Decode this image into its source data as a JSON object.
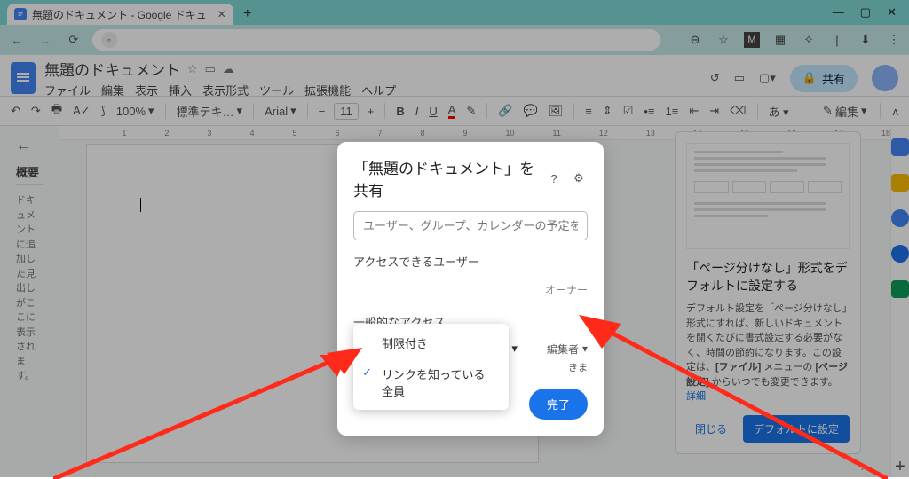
{
  "browser": {
    "tab_title": "無題のドキュメント - Google ドキュ",
    "win": {
      "min": "—",
      "max": "▢",
      "close": "✕"
    }
  },
  "docs": {
    "title": "無題のドキュメント",
    "menus": [
      "ファイル",
      "編集",
      "表示",
      "挿入",
      "表示形式",
      "ツール",
      "拡張機能",
      "ヘルプ"
    ],
    "share_label": "共有"
  },
  "toolbar": {
    "zoom": "100%",
    "style": "標準テキ…",
    "font": "Arial",
    "font_size": "11",
    "edit_mode": "編集"
  },
  "outline": {
    "heading": "概要",
    "hint": "ドキュメントに追加した見出しがここに表示されます。"
  },
  "ruler_marks": [
    "1",
    "2",
    "3",
    "4",
    "5",
    "6",
    "7",
    "8",
    "9",
    "10",
    "11",
    "12",
    "13",
    "14",
    "15",
    "16",
    "17",
    "18"
  ],
  "companion": {
    "title": "「ページ分けなし」形式をデフォルトに設定する",
    "body_pre": "デフォルト設定を「ページ分けなし」形式にすれば、新しいドキュメントを開くたびに書式設定する必要がなく、時間の節約になります。この設定は、",
    "bold1": "[ファイル]",
    "mid": " メニューの ",
    "bold2": "[ページ設定]",
    "body_post": " からいつでも変更できます。",
    "link": "詳細",
    "dismiss": "閉じる",
    "set_default": "デフォルトに設定"
  },
  "share": {
    "title_prefix": "「無題のドキュメント」を共有",
    "add_placeholder": "ユーザー、グループ、カレンダーの予定を追加",
    "section_users": "アクセスできるユーザー",
    "owner": "オーナー",
    "section_general": "一般的なアクセス",
    "access_drop": "リンクを知っている全員",
    "role": "編集者",
    "access_note_suffix": "きま",
    "done": "完了"
  },
  "dropdown": {
    "opt_restricted": "制限付き",
    "opt_anyone": "リンクを知っている全員"
  }
}
